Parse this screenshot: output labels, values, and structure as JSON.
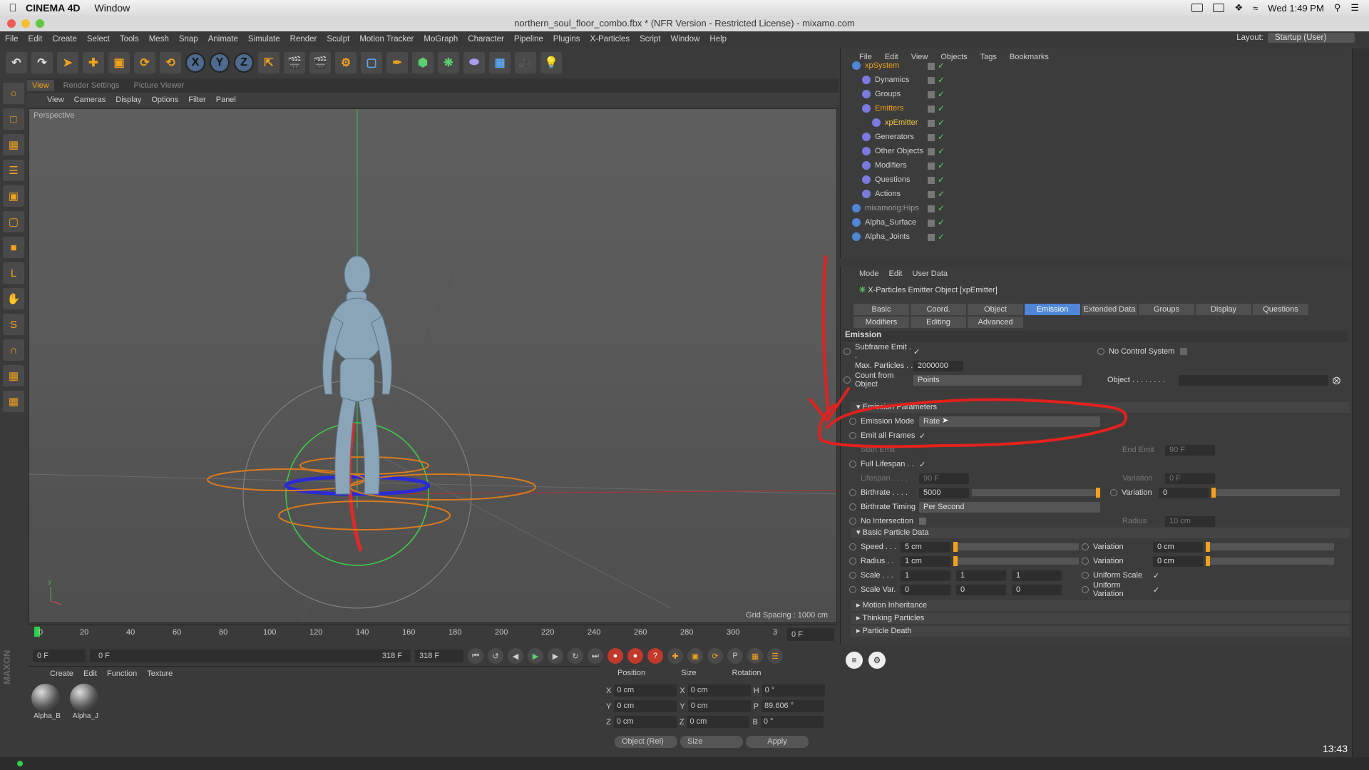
{
  "mac": {
    "app": "CINEMA 4D",
    "menu": [
      "Window"
    ],
    "time": "Wed 1:49 PM"
  },
  "window_title": "northern_soul_floor_combo.fbx * (NFR Version - Restricted License) - mixamo.com",
  "menu": [
    "File",
    "Edit",
    "Create",
    "Select",
    "Tools",
    "Mesh",
    "Snap",
    "Animate",
    "Simulate",
    "Render",
    "Sculpt",
    "Motion Tracker",
    "MoGraph",
    "Character",
    "Pipeline",
    "Plugins",
    "X-Particles",
    "Script",
    "Window",
    "Help"
  ],
  "layout": {
    "label": "Layout:",
    "value": "Startup (User)"
  },
  "toolbar_axes": [
    "X",
    "Y",
    "Z"
  ],
  "viewport": {
    "tabs": [
      "View",
      "Render Settings",
      "Picture Viewer"
    ],
    "menu": [
      "View",
      "Cameras",
      "Display",
      "Options",
      "Filter",
      "Panel"
    ],
    "label": "Perspective",
    "grid_spacing": "Grid Spacing : 1000 cm"
  },
  "timeline": {
    "ticks": [
      "0",
      "20",
      "40",
      "60",
      "80",
      "100",
      "120",
      "140",
      "160",
      "180",
      "200",
      "220",
      "240",
      "260",
      "280",
      "300",
      "3"
    ],
    "current_frame": "0 F",
    "start": "0 F",
    "range_start": "0 F",
    "range_end": "318 F",
    "end": "318 F"
  },
  "materials": {
    "menu": [
      "Create",
      "Edit",
      "Function",
      "Texture"
    ],
    "items": [
      "Alpha_B",
      "Alpha_J"
    ]
  },
  "coords": {
    "headers": [
      "Position",
      "Size",
      "Rotation"
    ],
    "rows": [
      {
        "axis": "X",
        "pos": "0 cm",
        "saxis": "X",
        "size": "0 cm",
        "raxis": "H",
        "rot": "0 °"
      },
      {
        "axis": "Y",
        "pos": "0 cm",
        "saxis": "Y",
        "size": "0 cm",
        "raxis": "P",
        "rot": "89.606 °"
      },
      {
        "axis": "Z",
        "pos": "0 cm",
        "saxis": "Z",
        "size": "0 cm",
        "raxis": "B",
        "rot": "0 °"
      }
    ],
    "mode": "Object (Rel)",
    "size_mode": "Size",
    "apply": "Apply"
  },
  "objects": {
    "menu": [
      "File",
      "Edit",
      "View",
      "Objects",
      "Tags",
      "Bookmarks"
    ],
    "items": [
      {
        "name": "xpSystem",
        "indent": 0,
        "color": "#f2a21b"
      },
      {
        "name": "Dynamics",
        "indent": 1,
        "color": "#cfcfcf"
      },
      {
        "name": "Groups",
        "indent": 1,
        "color": "#cfcfcf"
      },
      {
        "name": "Emitters",
        "indent": 1,
        "color": "#f2a21b"
      },
      {
        "name": "xpEmitter",
        "indent": 2,
        "color": "#f5c542"
      },
      {
        "name": "Generators",
        "indent": 1,
        "color": "#cfcfcf"
      },
      {
        "name": "Other Objects",
        "indent": 1,
        "color": "#cfcfcf"
      },
      {
        "name": "Modifiers",
        "indent": 1,
        "color": "#cfcfcf"
      },
      {
        "name": "Questions",
        "indent": 1,
        "color": "#cfcfcf"
      },
      {
        "name": "Actions",
        "indent": 1,
        "color": "#cfcfcf"
      },
      {
        "name": "mixamorig:Hips",
        "indent": 0,
        "color": "#9a9a9a"
      },
      {
        "name": "Alpha_Surface",
        "indent": 0,
        "color": "#cfcfcf"
      },
      {
        "name": "Alpha_Joints",
        "indent": 0,
        "color": "#cfcfcf"
      }
    ]
  },
  "attributes": {
    "menu": [
      "Mode",
      "Edit",
      "User Data"
    ],
    "title": "X-Particles Emitter Object [xpEmitter]",
    "tabs_row1": [
      "Basic",
      "Coord.",
      "Object",
      "Emission",
      "Extended Data",
      "Groups",
      "Display",
      "Questions"
    ],
    "tabs_row2": [
      "Modifiers",
      "Editing",
      "Advanced"
    ],
    "section": "Emission",
    "subframe_label": "Subframe Emit . .",
    "no_control_label": "No Control System",
    "max_particles_label": "Max. Particles . .",
    "max_particles": "2000000",
    "count_from_label": "Count from Object",
    "count_from": "Points",
    "object_label": "Object . . . . . . . .",
    "emission_params": "Emission Parameters",
    "emission_mode_label": "Emission Mode",
    "emission_mode": "Rate",
    "emit_all_label": "Emit all Frames",
    "start_emit_label": "Start Emit",
    "end_emit_label": "End Emit",
    "end_emit": "90 F",
    "full_lifespan_label": "Full Lifespan . .",
    "lifespan_label": "Lifespan . . . .",
    "lifespan": "90 F",
    "variation_label": "Variation",
    "lifespan_variation": "0 F",
    "birthrate_label": "Birthrate . . . .",
    "birthrate": "5000",
    "birthrate_variation": "0",
    "birthrate_timing_label": "Birthrate Timing",
    "birthrate_timing": "Per Second",
    "no_intersection_label": "No Intersection",
    "radius_label": "Radius",
    "radius_dim": "10 cm",
    "basic_particle": "Basic Particle Data",
    "speed_label": "Speed . . .",
    "speed": "5 cm",
    "speed_variation": "0 cm",
    "radius2_label": "Radius . .",
    "radius2": "1 cm",
    "radius_variation": "0 cm",
    "scale_label": "Scale . . .",
    "scale": [
      "1",
      "1",
      "1"
    ],
    "uniform_scale_label": "Uniform Scale",
    "scalevar_label": "Scale Var.",
    "scalevar": [
      "0",
      "0",
      "0"
    ],
    "uniform_variation_label": "Uniform Variation",
    "collapsed": [
      "Motion Inheritance",
      "Thinking Particles",
      "Particle Death"
    ]
  },
  "clock": "13:43",
  "annotation_color": "#e3211d"
}
